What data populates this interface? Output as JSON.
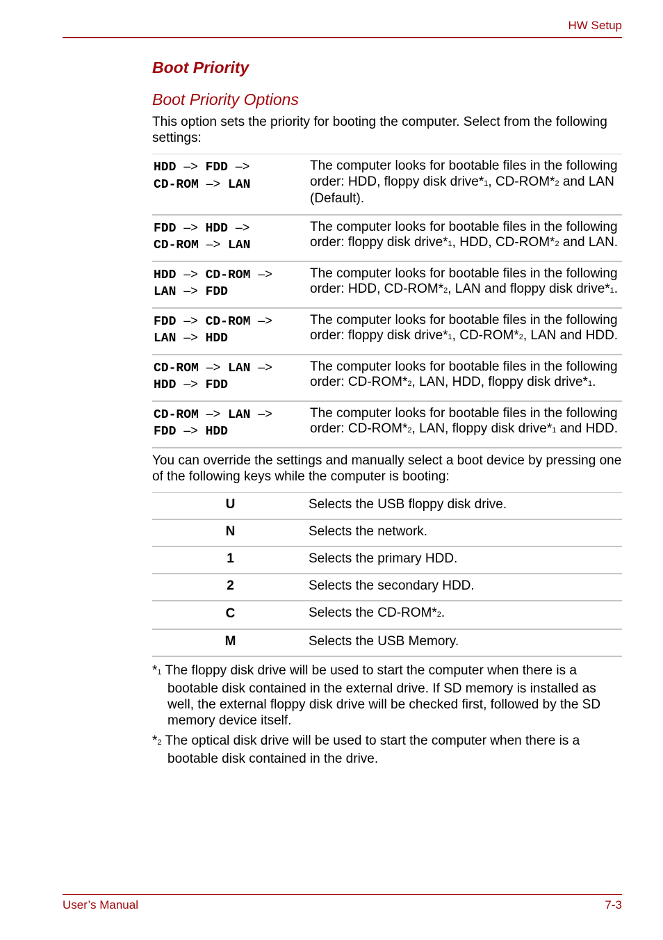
{
  "header": {
    "section": "HW Setup"
  },
  "footer": {
    "left": "User’s Manual",
    "right": "7-3"
  },
  "title": "Boot Priority",
  "subtitle": "Boot Priority Options",
  "intro": "This option sets the priority for booting the computer. Select from the following settings:",
  "arrow": "–>",
  "options": [
    {
      "seq": [
        "HDD",
        "FDD",
        "CD-ROM",
        "LAN"
      ],
      "desc": [
        "The computer looks for bootable files in the following order: HDD, floppy disk drive*",
        "1",
        ", CD-ROM*",
        "2",
        " and LAN (Default)."
      ]
    },
    {
      "seq": [
        "FDD",
        "HDD",
        "CD-ROM",
        "LAN"
      ],
      "desc": [
        "The computer looks for bootable files in the following order: floppy disk drive*",
        "1",
        ", HDD, CD-ROM*",
        "2",
        " and LAN."
      ]
    },
    {
      "seq": [
        "HDD",
        "CD-ROM",
        "LAN",
        "FDD"
      ],
      "desc": [
        "The computer looks for bootable files in the following order: HDD, CD-ROM*",
        "2",
        ", LAN and floppy disk drive*",
        "1",
        "."
      ]
    },
    {
      "seq": [
        "FDD",
        "CD-ROM",
        "LAN",
        "HDD"
      ],
      "desc": [
        "The computer looks for bootable files in the following order: floppy disk drive*",
        "1",
        ", CD-ROM*",
        "2",
        ", LAN and HDD."
      ]
    },
    {
      "seq": [
        "CD-ROM",
        "LAN",
        "HDD",
        "FDD"
      ],
      "desc": [
        "The computer looks for bootable files in the following order: CD-ROM*",
        "2",
        ", LAN, HDD, floppy disk drive*",
        "1",
        "."
      ]
    },
    {
      "seq": [
        "CD-ROM",
        "LAN",
        "FDD",
        "HDD"
      ],
      "desc": [
        "The computer looks for bootable files in the following order: CD-ROM*",
        "2",
        ", LAN, floppy disk drive*",
        "1",
        " and HDD."
      ]
    }
  ],
  "override": "You can override the settings and manually select a boot device by pressing one of the following keys while the computer is booting:",
  "keys": [
    {
      "key": "U",
      "desc": "Selects the USB floppy disk drive.",
      "sup": ""
    },
    {
      "key": "N",
      "desc": "Selects the network.",
      "sup": ""
    },
    {
      "key": "1",
      "desc": "Selects the primary HDD.",
      "sup": ""
    },
    {
      "key": "2",
      "desc": "Selects the secondary HDD.",
      "sup": ""
    },
    {
      "key": "C",
      "desc": "Selects the CD-ROM*",
      "sup": "2",
      "after": "."
    },
    {
      "key": "M",
      "desc": "Selects the USB Memory.",
      "sup": ""
    }
  ],
  "notes": [
    {
      "mark": "*",
      "num": "1",
      "text": " The floppy disk drive will be used to start the computer when there is a bootable disk contained in the external drive. If SD memory is installed as well, the external floppy disk drive will be checked first, followed by the SD memory device itself."
    },
    {
      "mark": "*",
      "num": "2",
      "text": " The optical disk drive will be used to start the computer when there is a bootable disk contained in the drive."
    }
  ]
}
